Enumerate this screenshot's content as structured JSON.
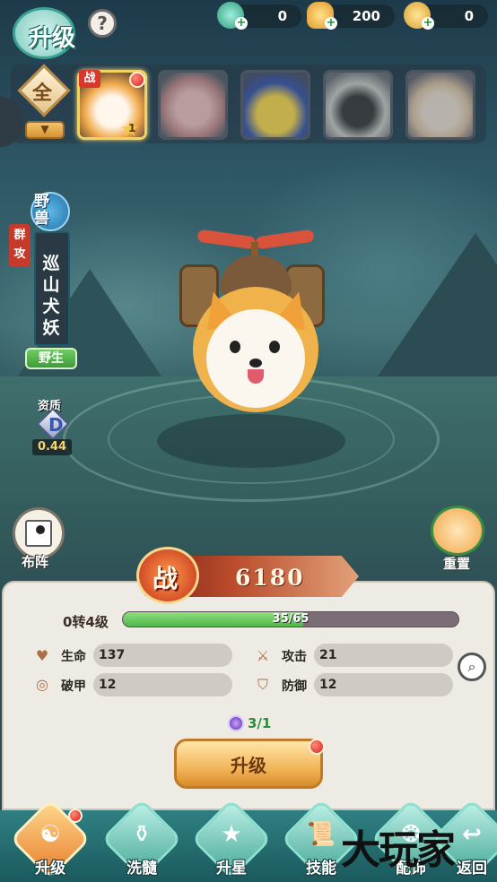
{
  "title": "升级",
  "help_icon": "?",
  "currencies": [
    {
      "icon": "jade-dragon-icon",
      "value": "0"
    },
    {
      "icon": "gold-ingot-icon",
      "value": "200"
    },
    {
      "icon": "gold-coin-icon",
      "value": "0"
    }
  ],
  "filter": {
    "label": "全"
  },
  "portrait_strip": {
    "active_badge": "战",
    "active_stars": "1",
    "pets": [
      "corgi",
      "pig",
      "chick",
      "sheep",
      "fox"
    ]
  },
  "pet": {
    "type": "野兽",
    "attack_tag": "群攻",
    "name": "巡山犬妖",
    "origin": "野生",
    "quality_label": "资质",
    "quality_grade": "D",
    "quality_value": "0.44"
  },
  "buttons": {
    "formation": "布阵",
    "reset": "重置"
  },
  "power": {
    "label": "战",
    "value": "6180"
  },
  "level": {
    "text": "0转4级",
    "xp": "35/65",
    "xp_fraction": 0.538
  },
  "stats": [
    {
      "label": "生命",
      "value": "137",
      "icon": "heart-icon"
    },
    {
      "label": "攻击",
      "value": "21",
      "icon": "sword-icon"
    },
    {
      "label": "破甲",
      "value": "12",
      "icon": "target-icon"
    },
    {
      "label": "防御",
      "value": "12",
      "icon": "shield-icon"
    }
  ],
  "cost": {
    "value": "3/1"
  },
  "upgrade_button": "升级",
  "nav": [
    {
      "label": "升级",
      "glyph": "☯"
    },
    {
      "label": "洗髓",
      "glyph": "⚱"
    },
    {
      "label": "升星",
      "glyph": "★"
    },
    {
      "label": "技能",
      "glyph": "📜"
    },
    {
      "label": "配饰",
      "glyph": "❂"
    },
    {
      "label": "返回",
      "glyph": "↩"
    }
  ],
  "watermark": "大玩家"
}
